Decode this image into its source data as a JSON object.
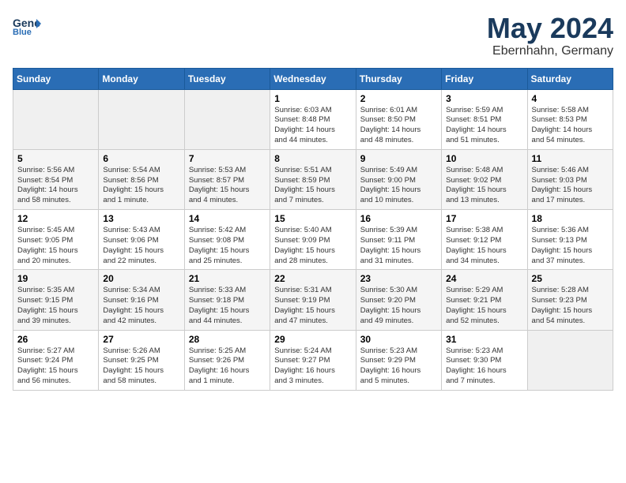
{
  "logo": {
    "general": "General",
    "blue": "Blue",
    "icon": "▶"
  },
  "title": {
    "month": "May 2024",
    "location": "Ebernhahn, Germany"
  },
  "weekdays": [
    "Sunday",
    "Monday",
    "Tuesday",
    "Wednesday",
    "Thursday",
    "Friday",
    "Saturday"
  ],
  "weeks": [
    [
      {
        "day": "",
        "info": ""
      },
      {
        "day": "",
        "info": ""
      },
      {
        "day": "",
        "info": ""
      },
      {
        "day": "1",
        "info": "Sunrise: 6:03 AM\nSunset: 8:48 PM\nDaylight: 14 hours\nand 44 minutes."
      },
      {
        "day": "2",
        "info": "Sunrise: 6:01 AM\nSunset: 8:50 PM\nDaylight: 14 hours\nand 48 minutes."
      },
      {
        "day": "3",
        "info": "Sunrise: 5:59 AM\nSunset: 8:51 PM\nDaylight: 14 hours\nand 51 minutes."
      },
      {
        "day": "4",
        "info": "Sunrise: 5:58 AM\nSunset: 8:53 PM\nDaylight: 14 hours\nand 54 minutes."
      }
    ],
    [
      {
        "day": "5",
        "info": "Sunrise: 5:56 AM\nSunset: 8:54 PM\nDaylight: 14 hours\nand 58 minutes."
      },
      {
        "day": "6",
        "info": "Sunrise: 5:54 AM\nSunset: 8:56 PM\nDaylight: 15 hours\nand 1 minute."
      },
      {
        "day": "7",
        "info": "Sunrise: 5:53 AM\nSunset: 8:57 PM\nDaylight: 15 hours\nand 4 minutes."
      },
      {
        "day": "8",
        "info": "Sunrise: 5:51 AM\nSunset: 8:59 PM\nDaylight: 15 hours\nand 7 minutes."
      },
      {
        "day": "9",
        "info": "Sunrise: 5:49 AM\nSunset: 9:00 PM\nDaylight: 15 hours\nand 10 minutes."
      },
      {
        "day": "10",
        "info": "Sunrise: 5:48 AM\nSunset: 9:02 PM\nDaylight: 15 hours\nand 13 minutes."
      },
      {
        "day": "11",
        "info": "Sunrise: 5:46 AM\nSunset: 9:03 PM\nDaylight: 15 hours\nand 17 minutes."
      }
    ],
    [
      {
        "day": "12",
        "info": "Sunrise: 5:45 AM\nSunset: 9:05 PM\nDaylight: 15 hours\nand 20 minutes."
      },
      {
        "day": "13",
        "info": "Sunrise: 5:43 AM\nSunset: 9:06 PM\nDaylight: 15 hours\nand 22 minutes."
      },
      {
        "day": "14",
        "info": "Sunrise: 5:42 AM\nSunset: 9:08 PM\nDaylight: 15 hours\nand 25 minutes."
      },
      {
        "day": "15",
        "info": "Sunrise: 5:40 AM\nSunset: 9:09 PM\nDaylight: 15 hours\nand 28 minutes."
      },
      {
        "day": "16",
        "info": "Sunrise: 5:39 AM\nSunset: 9:11 PM\nDaylight: 15 hours\nand 31 minutes."
      },
      {
        "day": "17",
        "info": "Sunrise: 5:38 AM\nSunset: 9:12 PM\nDaylight: 15 hours\nand 34 minutes."
      },
      {
        "day": "18",
        "info": "Sunrise: 5:36 AM\nSunset: 9:13 PM\nDaylight: 15 hours\nand 37 minutes."
      }
    ],
    [
      {
        "day": "19",
        "info": "Sunrise: 5:35 AM\nSunset: 9:15 PM\nDaylight: 15 hours\nand 39 minutes."
      },
      {
        "day": "20",
        "info": "Sunrise: 5:34 AM\nSunset: 9:16 PM\nDaylight: 15 hours\nand 42 minutes."
      },
      {
        "day": "21",
        "info": "Sunrise: 5:33 AM\nSunset: 9:18 PM\nDaylight: 15 hours\nand 44 minutes."
      },
      {
        "day": "22",
        "info": "Sunrise: 5:31 AM\nSunset: 9:19 PM\nDaylight: 15 hours\nand 47 minutes."
      },
      {
        "day": "23",
        "info": "Sunrise: 5:30 AM\nSunset: 9:20 PM\nDaylight: 15 hours\nand 49 minutes."
      },
      {
        "day": "24",
        "info": "Sunrise: 5:29 AM\nSunset: 9:21 PM\nDaylight: 15 hours\nand 52 minutes."
      },
      {
        "day": "25",
        "info": "Sunrise: 5:28 AM\nSunset: 9:23 PM\nDaylight: 15 hours\nand 54 minutes."
      }
    ],
    [
      {
        "day": "26",
        "info": "Sunrise: 5:27 AM\nSunset: 9:24 PM\nDaylight: 15 hours\nand 56 minutes."
      },
      {
        "day": "27",
        "info": "Sunrise: 5:26 AM\nSunset: 9:25 PM\nDaylight: 15 hours\nand 58 minutes."
      },
      {
        "day": "28",
        "info": "Sunrise: 5:25 AM\nSunset: 9:26 PM\nDaylight: 16 hours\nand 1 minute."
      },
      {
        "day": "29",
        "info": "Sunrise: 5:24 AM\nSunset: 9:27 PM\nDaylight: 16 hours\nand 3 minutes."
      },
      {
        "day": "30",
        "info": "Sunrise: 5:23 AM\nSunset: 9:29 PM\nDaylight: 16 hours\nand 5 minutes."
      },
      {
        "day": "31",
        "info": "Sunrise: 5:23 AM\nSunset: 9:30 PM\nDaylight: 16 hours\nand 7 minutes."
      },
      {
        "day": "",
        "info": ""
      }
    ]
  ]
}
